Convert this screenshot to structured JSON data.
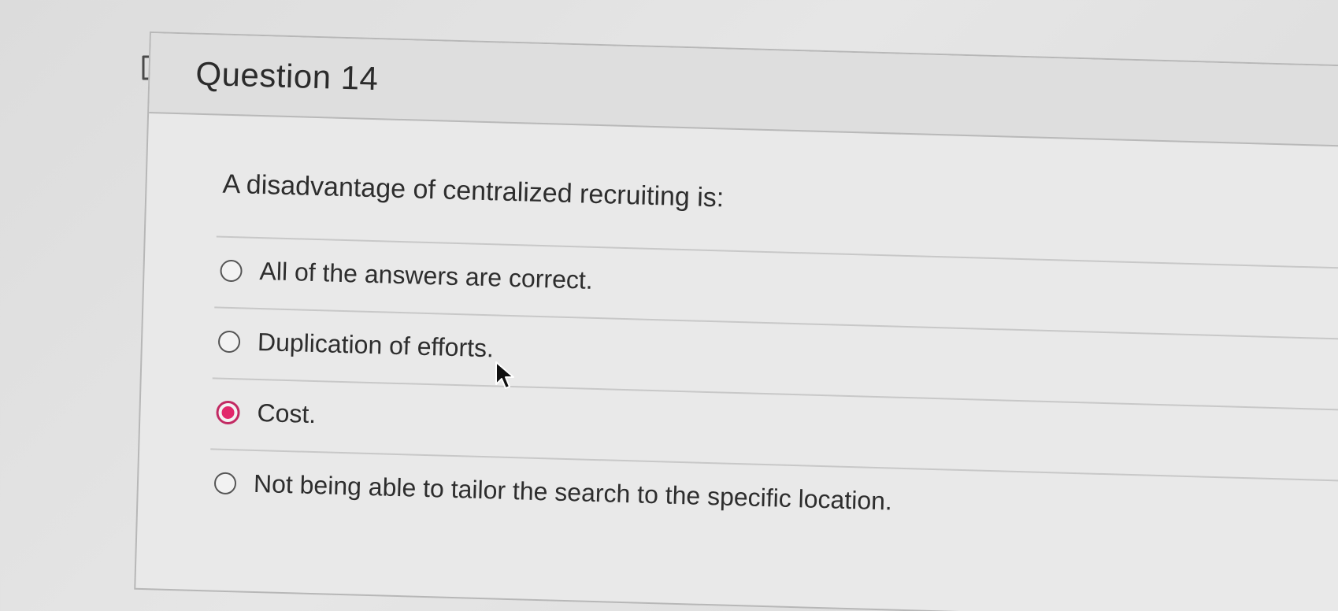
{
  "question": {
    "title": "Question 14",
    "prompt": "A disadvantage of centralized recruiting is:",
    "options": [
      {
        "label": "All of the answers are correct.",
        "selected": false
      },
      {
        "label": "Duplication of efforts.",
        "selected": false
      },
      {
        "label": "Cost.",
        "selected": true
      },
      {
        "label": "Not being able to tailor the search to the specific location.",
        "selected": false
      }
    ]
  },
  "colors": {
    "selected_radio": "#e2276b",
    "page_background": "#e0e0e0"
  },
  "icons": {
    "flag": "flag-outline-icon",
    "cursor": "mouse-pointer-icon"
  }
}
